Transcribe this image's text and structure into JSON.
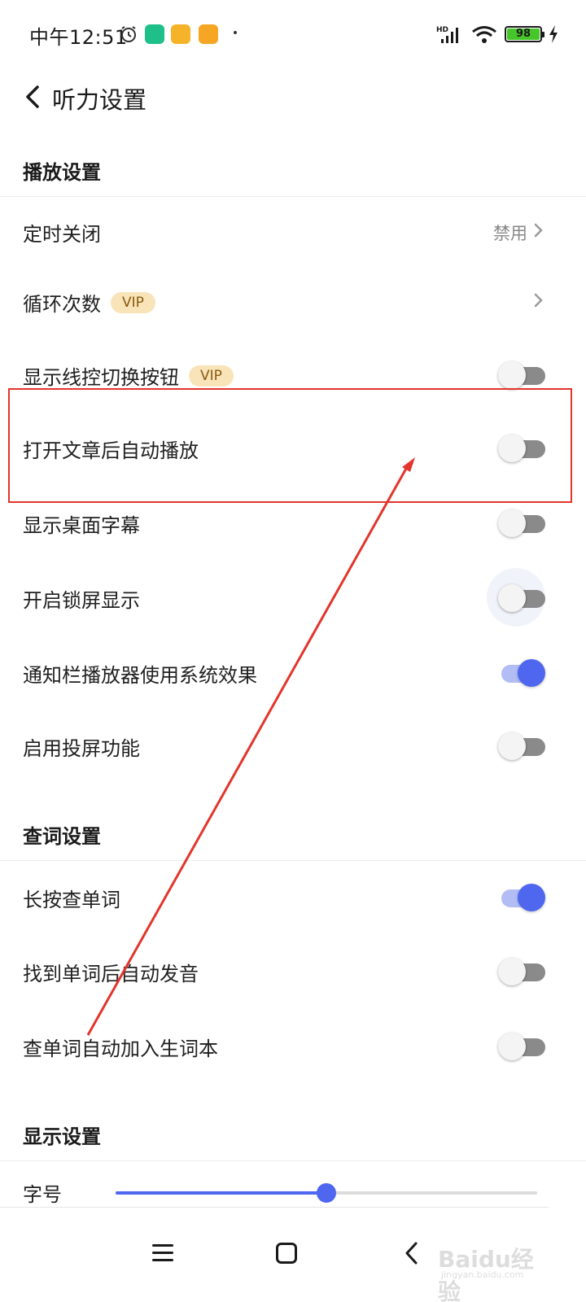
{
  "status_bar": {
    "time": "中午12:51",
    "battery": "98",
    "network": "HD"
  },
  "header": {
    "title": "听力设置"
  },
  "sections": {
    "playback": "播放设置",
    "lookup": "查词设置",
    "display": "显示设置"
  },
  "rows": {
    "timer_off": {
      "label": "定时关闭",
      "value": "禁用"
    },
    "loop_count": {
      "label": "循环次数",
      "badge": "VIP"
    },
    "show_wire_switch": {
      "label": "显示线控切换按钮",
      "badge": "VIP",
      "on": false
    },
    "auto_play_after_open": {
      "label": "打开文章后自动播放",
      "on": false
    },
    "desktop_subtitles": {
      "label": "显示桌面字幕",
      "on": false
    },
    "lockscreen_display": {
      "label": "开启锁屏显示",
      "on": false
    },
    "notification_system_effect": {
      "label": "通知栏播放器使用系统效果",
      "on": true
    },
    "screen_cast": {
      "label": "启用投屏功能",
      "on": false
    },
    "long_press_lookup": {
      "label": "长按查单词",
      "on": true
    },
    "auto_pronounce": {
      "label": "找到单词后自动发音",
      "on": false
    },
    "auto_add_vocab": {
      "label": "查单词自动加入生词本",
      "on": false
    },
    "font_size": {
      "label": "字号",
      "slider_fraction": 0.5
    }
  },
  "watermark": {
    "text": "Baidu经验",
    "url": "jingyan.baidu.com"
  },
  "colors": {
    "accent": "#4e67ee",
    "annotation": "#e3352c",
    "vip_bg": "#f8e4b8"
  }
}
